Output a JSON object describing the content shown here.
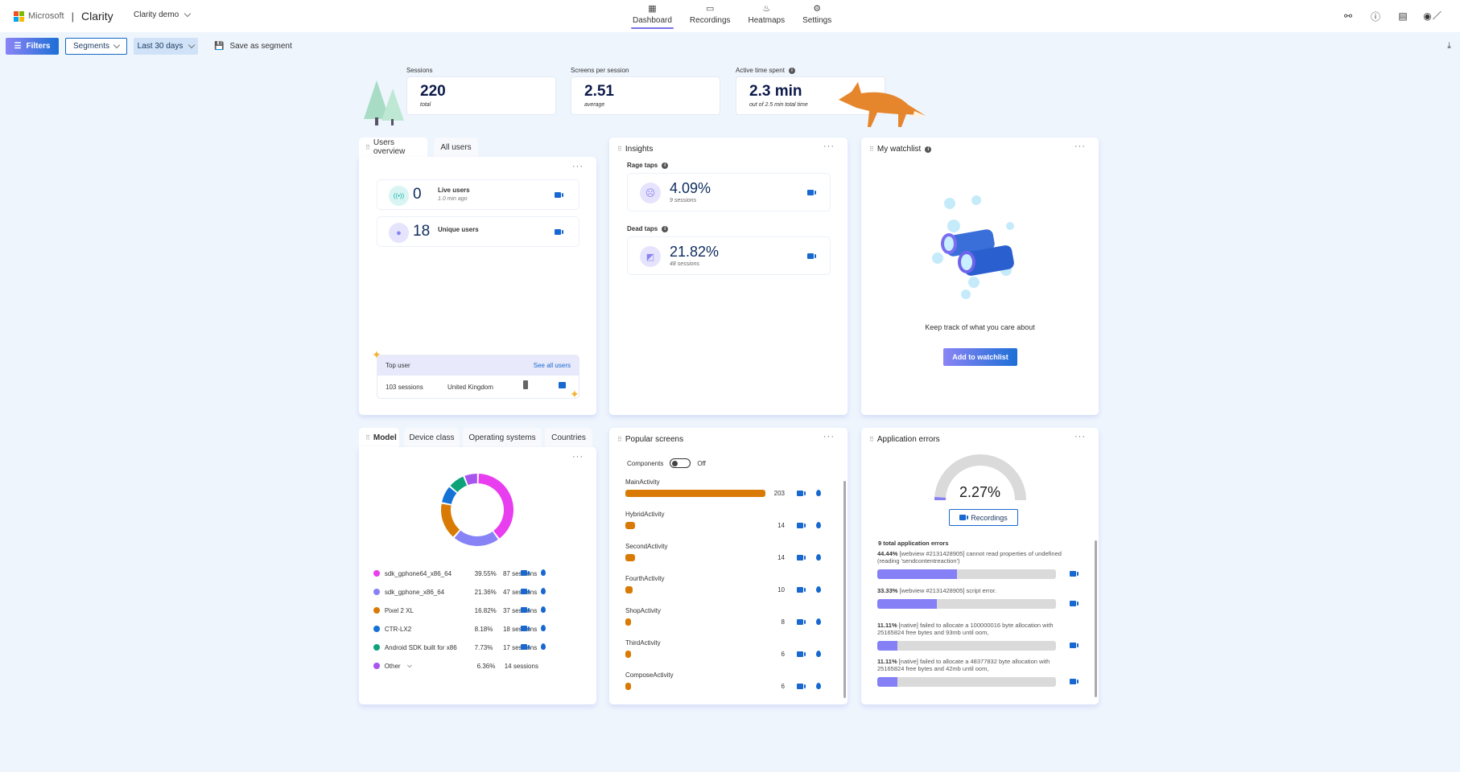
{
  "header": {
    "brand": "Microsoft",
    "app_name": "Clarity",
    "project": "Clarity demo",
    "nav": [
      {
        "label": "Dashboard",
        "icon": "dashboard-icon",
        "active": true
      },
      {
        "label": "Recordings",
        "icon": "video-icon"
      },
      {
        "label": "Heatmaps",
        "icon": "flame-icon"
      },
      {
        "label": "Settings",
        "icon": "gear-icon"
      }
    ],
    "right_icons": [
      "share-icon",
      "help-icon",
      "document-icon",
      "account-icon"
    ]
  },
  "toolbar": {
    "filters": "Filters",
    "segments": "Segments",
    "date_range": "Last 30 days",
    "save_segment": "Save as segment"
  },
  "stats": [
    {
      "label": "Sessions",
      "value": "220",
      "sub": "total"
    },
    {
      "label": "Screens per session",
      "value": "2.51",
      "sub": "average"
    },
    {
      "label": "Active time spent",
      "value": "2.3 min",
      "sub": "out of 2.5 min total time"
    }
  ],
  "users_overview": {
    "tabs": [
      "Users overview",
      "All users"
    ],
    "live": {
      "value": "0",
      "label": "Live users",
      "sub": "1.0 min ago"
    },
    "unique": {
      "value": "18",
      "label": "Unique users"
    },
    "top_user": {
      "title": "Top user",
      "link": "See all users",
      "sessions": "103 sessions",
      "country": "United Kingdom"
    }
  },
  "insights": {
    "title": "Insights",
    "rage": {
      "label": "Rage taps",
      "value": "4.09%",
      "sub": "9 sessions"
    },
    "dead": {
      "label": "Dead taps",
      "value": "21.82%",
      "sub": "48 sessions"
    }
  },
  "watchlist": {
    "title": "My watchlist",
    "message": "Keep track of what you care about",
    "button": "Add to watchlist"
  },
  "model": {
    "tabs": [
      "Model",
      "Device class",
      "Operating systems",
      "Countries"
    ],
    "items": [
      {
        "name": "sdk_gphone64_x86_64",
        "pct": "39.55%",
        "sessions": "87 sessions",
        "value": 39.55,
        "color": "#e83ef0"
      },
      {
        "name": "sdk_gphone_x86_64",
        "pct": "21.36%",
        "sessions": "47 sessions",
        "value": 21.36,
        "color": "#8783f7"
      },
      {
        "name": "Pixel 2 XL",
        "pct": "16.82%",
        "sessions": "37 sessions",
        "value": 16.82,
        "color": "#d97a05"
      },
      {
        "name": "CTR-LX2",
        "pct": "8.18%",
        "sessions": "18 sessions",
        "value": 8.18,
        "color": "#1473d6"
      },
      {
        "name": "Android SDK built for x86",
        "pct": "7.73%",
        "sessions": "17 sessions",
        "value": 7.73,
        "color": "#0ea27b"
      },
      {
        "name": "Other",
        "pct": "6.36%",
        "sessions": "14 sessions",
        "value": 6.36,
        "color": "#a855f0"
      }
    ]
  },
  "popular_screens": {
    "title": "Popular screens",
    "toggle_label": "Components",
    "toggle_state": "Off",
    "max": 203,
    "items": [
      {
        "name": "MainActivity",
        "count": 203
      },
      {
        "name": "HybridActivity",
        "count": 14
      },
      {
        "name": "SecondActivity",
        "count": 14
      },
      {
        "name": "FourthActivity",
        "count": 10
      },
      {
        "name": "ShopActivity",
        "count": 8
      },
      {
        "name": "ThirdActivity",
        "count": 6
      },
      {
        "name": "ComposeActivity",
        "count": 6
      }
    ]
  },
  "app_errors": {
    "title": "Application errors",
    "rate": "2.27%",
    "rate_value": 2.27,
    "button": "Recordings",
    "total": "9 total application errors",
    "items": [
      {
        "pct": "44.44%",
        "value": 44.44,
        "text": "[webview #2131428905] cannot read properties of undefined (reading 'sendcontentreaction')"
      },
      {
        "pct": "33.33%",
        "value": 33.33,
        "text": "[webview #2131428905] script error."
      },
      {
        "pct": "11.11%",
        "value": 11.11,
        "text": "[native] failed to allocate a 100000016 byte allocation with 25165824 free bytes and 93mb until oom,"
      },
      {
        "pct": "11.11%",
        "value": 11.11,
        "text": "[native] failed to allocate a 48377832 byte allocation with 25165824 free bytes and 42mb until oom,"
      }
    ]
  }
}
